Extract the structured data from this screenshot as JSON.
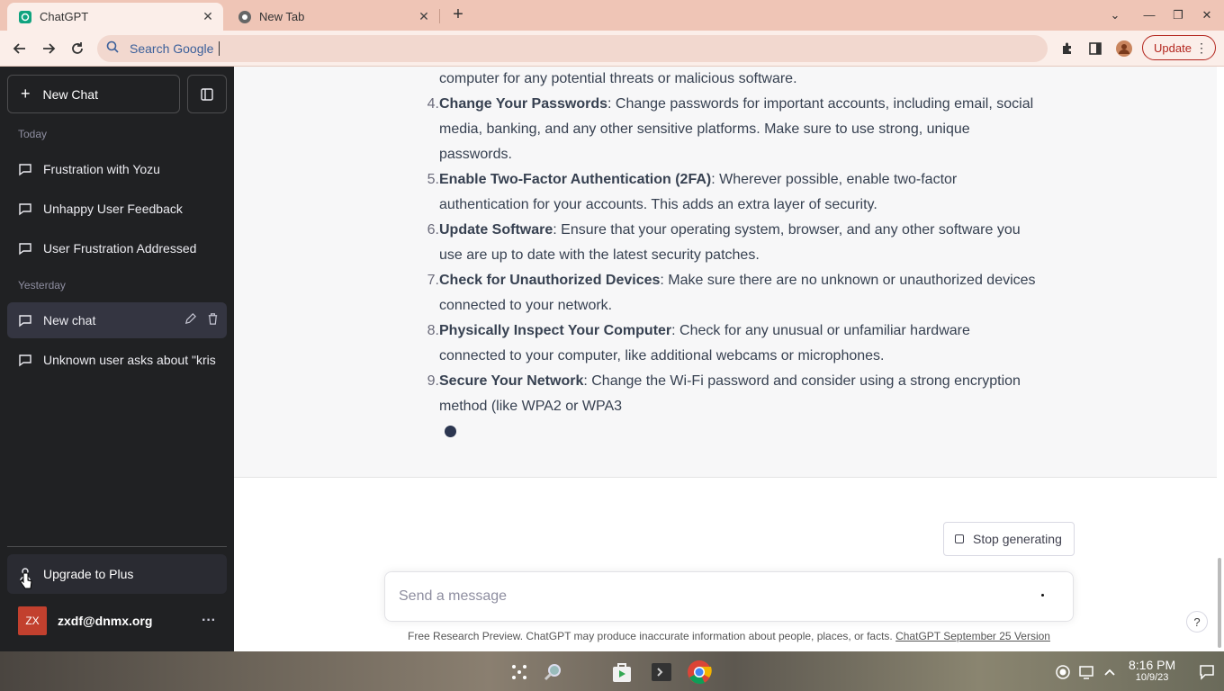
{
  "browser": {
    "tabs": [
      {
        "title": "ChatGPT",
        "active": true
      },
      {
        "title": "New Tab",
        "active": false
      }
    ],
    "omnibox_placeholder": "Search Google",
    "update_label": "Update"
  },
  "sidebar": {
    "new_chat_label": "New Chat",
    "sections": [
      {
        "label": "Today",
        "items": [
          "Frustration with Yozu",
          "Unhappy User Feedback",
          "User Frustration Addressed"
        ]
      },
      {
        "label": "Yesterday",
        "items": [
          "New chat",
          "Unknown user asks about \"kris"
        ]
      }
    ],
    "upgrade_label": "Upgrade to Plus",
    "user": {
      "initials": "ZX",
      "email": "zxdf@dnmx.org"
    }
  },
  "answer": {
    "lines": [
      {
        "num": "",
        "bold": "",
        "text": "computer for any potential threats or malicious software."
      },
      {
        "num": "4.",
        "bold": "Change Your Passwords",
        "text": ": Change passwords for important accounts, including email, social"
      },
      {
        "num": "",
        "bold": "",
        "text": "media, banking, and any other sensitive platforms. Make sure to use strong, unique"
      },
      {
        "num": "",
        "bold": "",
        "text": "passwords."
      },
      {
        "num": "5.",
        "bold": "Enable Two-Factor Authentication (2FA)",
        "text": ": Wherever possible, enable two-factor"
      },
      {
        "num": "",
        "bold": "",
        "text": "authentication for your accounts. This adds an extra layer of security."
      },
      {
        "num": "6.",
        "bold": "Update Software",
        "text": ": Ensure that your operating system, browser, and any other software you"
      },
      {
        "num": "",
        "bold": "",
        "text": "use are up to date with the latest security patches."
      },
      {
        "num": "7.",
        "bold": "Check for Unauthorized Devices",
        "text": ": Make sure there are no unknown or unauthorized devices"
      },
      {
        "num": "",
        "bold": "",
        "text": "connected to your network."
      },
      {
        "num": "8.",
        "bold": "Physically Inspect Your Computer",
        "text": ": Check for any unusual or unfamiliar hardware"
      },
      {
        "num": "",
        "bold": "",
        "text": "connected to your computer, like additional webcams or microphones."
      },
      {
        "num": "9.",
        "bold": "Secure Your Network",
        "text": ": Change the Wi-Fi password and consider using a strong encryption"
      },
      {
        "num": "",
        "bold": "",
        "text": "method (like WPA2 or WPA3"
      }
    ]
  },
  "composer": {
    "stop_label": "Stop generating",
    "placeholder": "Send a message",
    "footer_text": "Free Research Preview. ChatGPT may produce inaccurate information about people, places, or facts. ",
    "footer_link": "ChatGPT September 25 Version",
    "help": "?"
  },
  "taskbar": {
    "time": "8:16 PM",
    "date": "10/9/23"
  },
  "colors": {
    "sidebar_bg": "#202123",
    "tabbar_bg": "#efc5b6",
    "update_accent": "#b3261e",
    "avatar_bg": "#c2402e"
  }
}
